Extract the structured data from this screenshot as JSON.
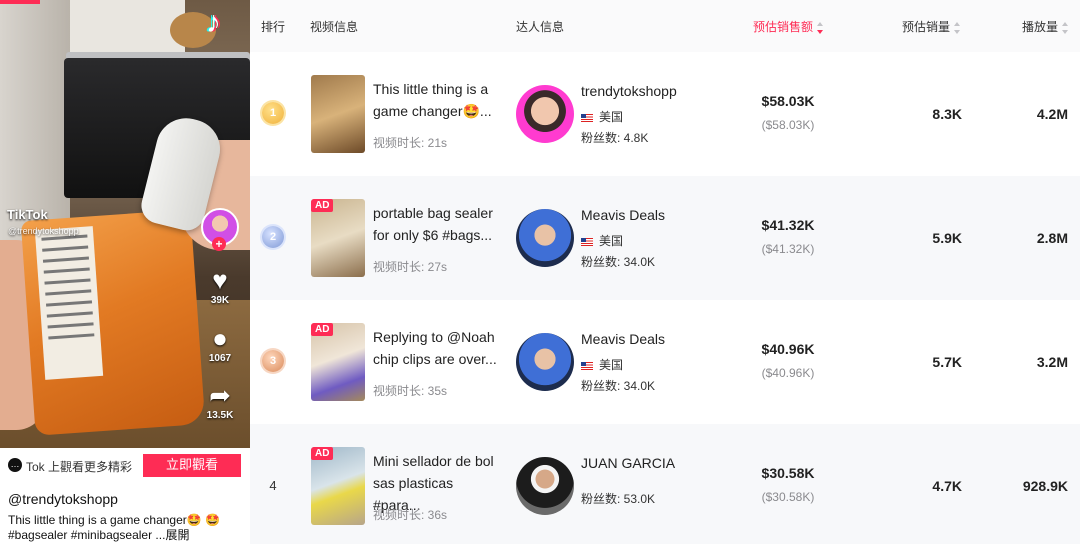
{
  "embed": {
    "brand": "TikTok",
    "handle_overlay": "@trendytokshopp",
    "stats": {
      "likes": "39K",
      "comments": "1067",
      "shares": "13.5K"
    },
    "cta_text": "Tok 上觀看更多精彩",
    "cta_button": "立即觀看",
    "author": "@trendytokshopp",
    "caption": "This little thing is a game changer🤩 🤩 #bagsealer #minibagsealer ...",
    "caption_more": "展開"
  },
  "table": {
    "headers": {
      "rank": "排行",
      "video": "视频信息",
      "creator": "达人信息",
      "sales": "预估销售额",
      "volume": "预估销量",
      "plays": "播放量"
    },
    "rows": [
      {
        "rank": "1",
        "ad": false,
        "title": "This little thing is a game changer🤩...",
        "duration": "视频时长: 21s",
        "creator": "trendytokshopp",
        "country": "美国",
        "fans": "粉丝数: 4.8K",
        "sales_main": "$58.03K",
        "sales_sub": "($58.03K)",
        "volume": "8.3K",
        "plays": "4.2M"
      },
      {
        "rank": "2",
        "ad": true,
        "ad_label": "AD",
        "title": "portable bag sealer for only $6 #bags...",
        "duration": "视频时长: 27s",
        "creator": "Meavis Deals",
        "country": "美国",
        "fans": "粉丝数: 34.0K",
        "sales_main": "$41.32K",
        "sales_sub": "($41.32K)",
        "volume": "5.9K",
        "plays": "2.8M"
      },
      {
        "rank": "3",
        "ad": true,
        "ad_label": "AD",
        "title": "Replying to @Noah chip clips are over...",
        "duration": "视频时长: 35s",
        "creator": "Meavis Deals",
        "country": "美国",
        "fans": "粉丝数: 34.0K",
        "sales_main": "$40.96K",
        "sales_sub": "($40.96K)",
        "volume": "5.7K",
        "plays": "3.2M"
      },
      {
        "rank": "4",
        "ad": true,
        "ad_label": "AD",
        "title": "Mini sellador de bol sas plasticas #para...",
        "duration": "视频时长: 36s",
        "creator": "JUAN GARCIA",
        "fans": "粉丝数: 53.0K",
        "sales_main": "$30.58K",
        "sales_sub": "($30.58K)",
        "volume": "4.7K",
        "plays": "928.9K"
      }
    ]
  },
  "colors": {
    "accent": "#fe2c55",
    "muted": "#8a8a8e",
    "header_bg": "#fafafb",
    "alt_row": "#f7f8fa"
  }
}
